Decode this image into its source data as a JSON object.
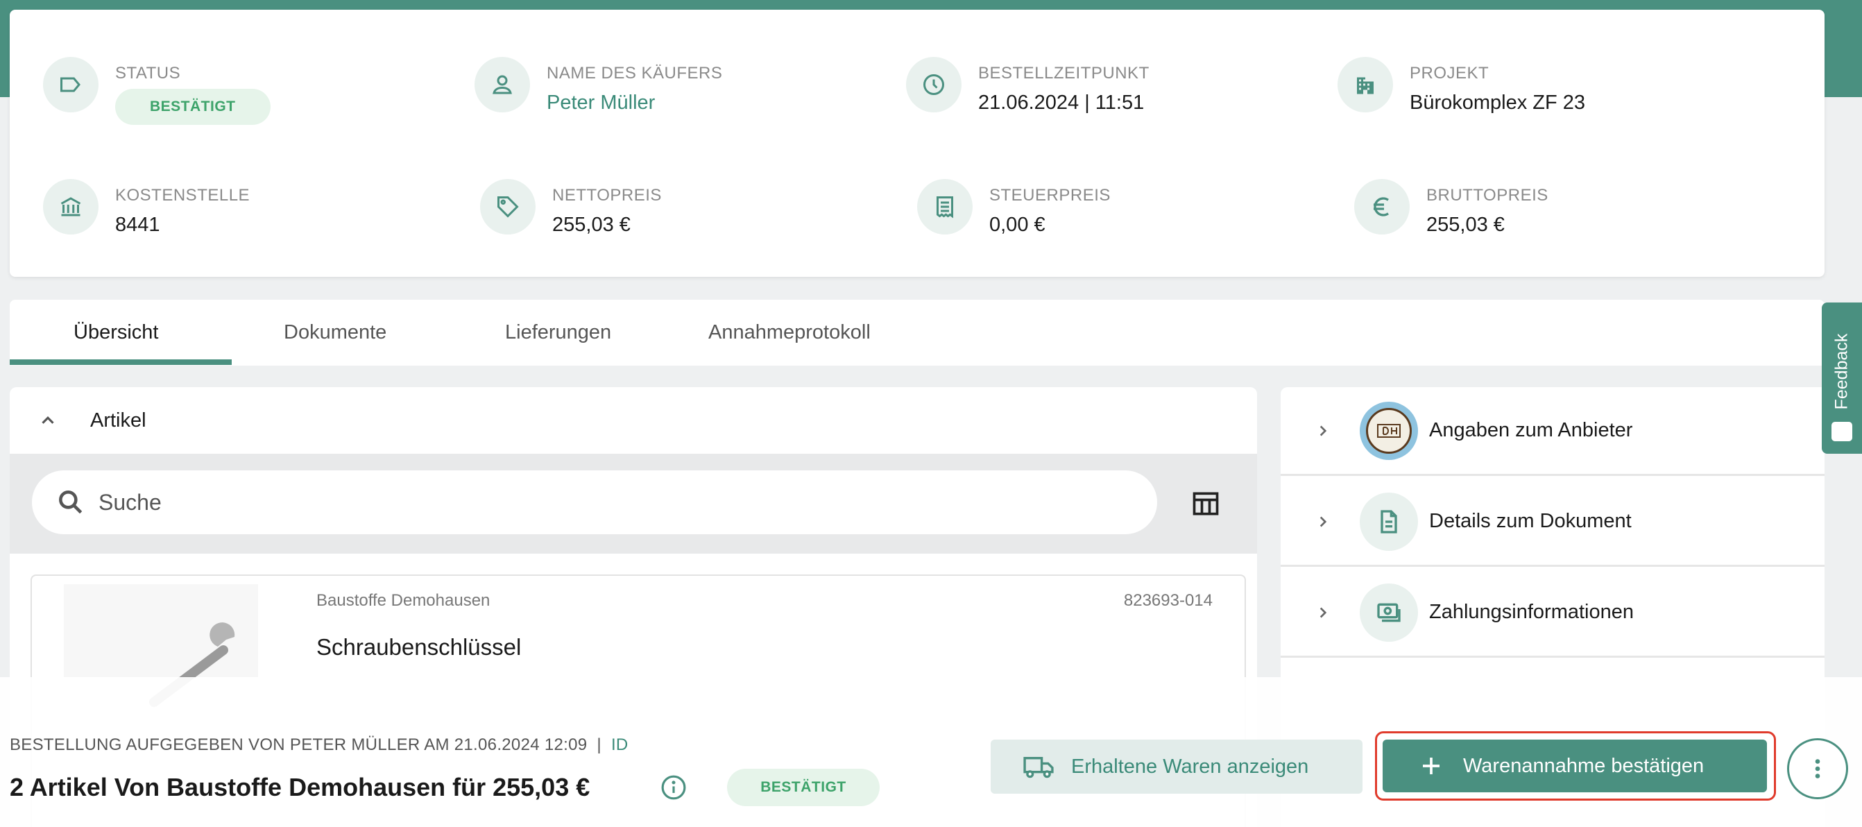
{
  "header": {
    "status": {
      "label": "STATUS",
      "value": "BESTÄTIGT",
      "icon": "label-icon"
    },
    "buyer": {
      "label": "NAME DES KÄUFERS",
      "value": "Peter Müller",
      "icon": "person-icon"
    },
    "order_time": {
      "label": "BESTELLZEITPUNKT",
      "value": "21.06.2024 | 11:51",
      "icon": "clock-icon"
    },
    "project": {
      "label": "PROJEKT",
      "value": "Bürokomplex ZF 23",
      "icon": "building-icon"
    },
    "cost_center": {
      "label": "KOSTENSTELLE",
      "value": "8441",
      "icon": "bank-icon"
    },
    "net_price": {
      "label": "NETTOPREIS",
      "value": "255,03 €",
      "icon": "tag-icon"
    },
    "tax_price": {
      "label": "STEUERPREIS",
      "value": "0,00 €",
      "icon": "receipt-icon"
    },
    "gross_price": {
      "label": "BRUTTOPREIS",
      "value": "255,03 €",
      "icon": "euro-icon"
    }
  },
  "tabs": [
    {
      "label": "Übersicht",
      "active": true
    },
    {
      "label": "Dokumente",
      "active": false
    },
    {
      "label": "Lieferungen",
      "active": false
    },
    {
      "label": "Annahmeprotokoll",
      "active": false
    }
  ],
  "articles": {
    "title": "Artikel",
    "search_placeholder": "Suche",
    "items": [
      {
        "vendor": "Baustoffe Demohausen",
        "sku": "823693-014",
        "name": "Schraubenschlüssel"
      }
    ]
  },
  "side_panel": {
    "rows": [
      {
        "label": "Angaben zum Anbieter",
        "icon": "vendor-logo"
      },
      {
        "label": "Details zum Dokument",
        "icon": "document-icon"
      },
      {
        "label": "Zahlungsinformationen",
        "icon": "payment-icon"
      }
    ]
  },
  "feedback": {
    "label": "Feedback"
  },
  "footer": {
    "meta": "BESTELLUNG AUFGEGEBEN VON PETER MÜLLER AM 21.06.2024 12:09",
    "separator": "|",
    "id_label": "ID",
    "title": "2 Artikel Von Baustoffe Demohausen für 255,03 €",
    "status_badge": "BESTÄTIGT",
    "btn_received": "Erhaltene Waren anzeigen",
    "btn_confirm": "Warenannahme bestätigen"
  },
  "colors": {
    "accent": "#4a9080",
    "accent_text": "#3a8a78",
    "success_bg": "#e6f4ea",
    "success_text": "#3da36a",
    "highlight": "#e03b2c"
  }
}
